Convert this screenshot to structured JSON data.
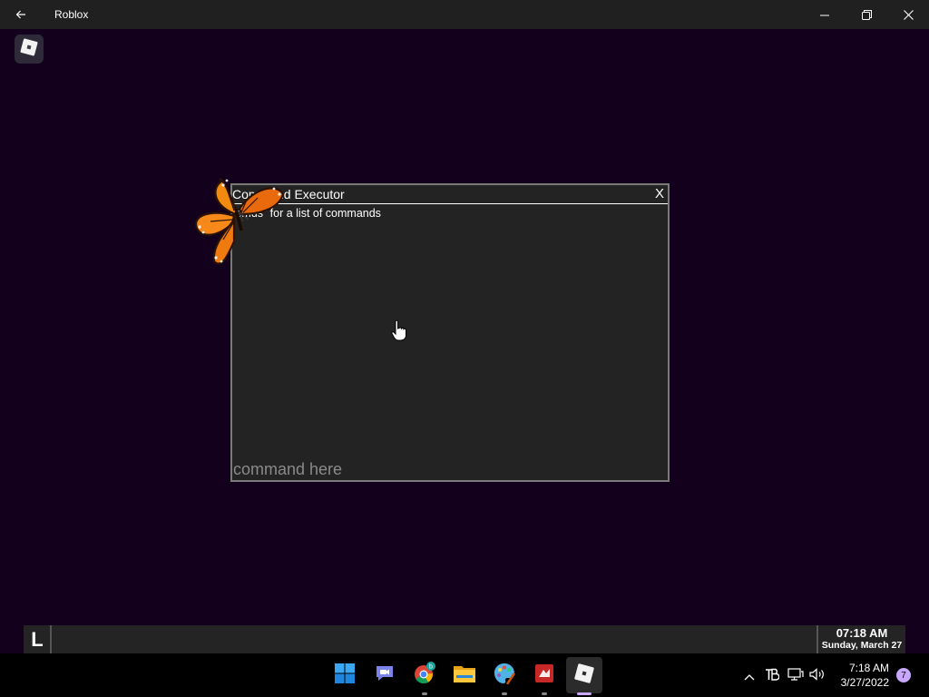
{
  "window": {
    "title": "Roblox",
    "back_icon": "arrow-left-icon",
    "minimize_icon": "minimize-icon",
    "restore_icon": "restore-icon",
    "close_icon": "close-icon"
  },
  "game": {
    "menu_icon": "roblox-logo-icon",
    "background_color": "#12001c"
  },
  "command_executor": {
    "title": "Command Executor",
    "close_label": "X",
    "hint": "“cmds” for a list of commands",
    "input_placeholder": "command here",
    "input_value": ""
  },
  "bottom_bar": {
    "badge": "L",
    "time": "07:18 AM",
    "date": "Sunday, March 27"
  },
  "taskbar": {
    "apps": [
      {
        "name": "start-icon"
      },
      {
        "name": "teams-chat-icon"
      },
      {
        "name": "chrome-icon",
        "badge": "b"
      },
      {
        "name": "file-explorer-icon"
      },
      {
        "name": "paint-icon"
      },
      {
        "name": "red-app-icon"
      },
      {
        "name": "roblox-icon",
        "active": true
      }
    ],
    "tray": {
      "chevron_icon": "chevron-up-icon",
      "icons": [
        "tb-app-icon",
        "network-icon",
        "volume-icon"
      ],
      "time": "7:18 AM",
      "date": "3/27/2022",
      "notifications": "7"
    }
  }
}
